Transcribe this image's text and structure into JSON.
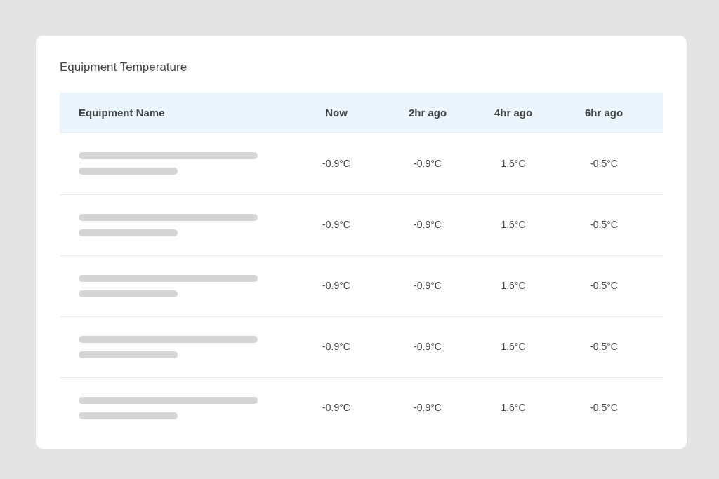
{
  "card": {
    "title": "Equipment Temperature"
  },
  "table": {
    "columns": [
      "Equipment Name",
      "Now",
      "2hr ago",
      "4hr ago",
      "6hr ago"
    ],
    "rows": [
      {
        "values": [
          "-0.9°C",
          "-0.9°C",
          "1.6°C",
          "-0.5°C"
        ]
      },
      {
        "values": [
          "-0.9°C",
          "-0.9°C",
          "1.6°C",
          "-0.5°C"
        ]
      },
      {
        "values": [
          "-0.9°C",
          "-0.9°C",
          "1.6°C",
          "-0.5°C"
        ]
      },
      {
        "values": [
          "-0.9°C",
          "-0.9°C",
          "1.6°C",
          "-0.5°C"
        ]
      },
      {
        "values": [
          "-0.9°C",
          "-0.9°C",
          "1.6°C",
          "-0.5°C"
        ]
      }
    ]
  }
}
